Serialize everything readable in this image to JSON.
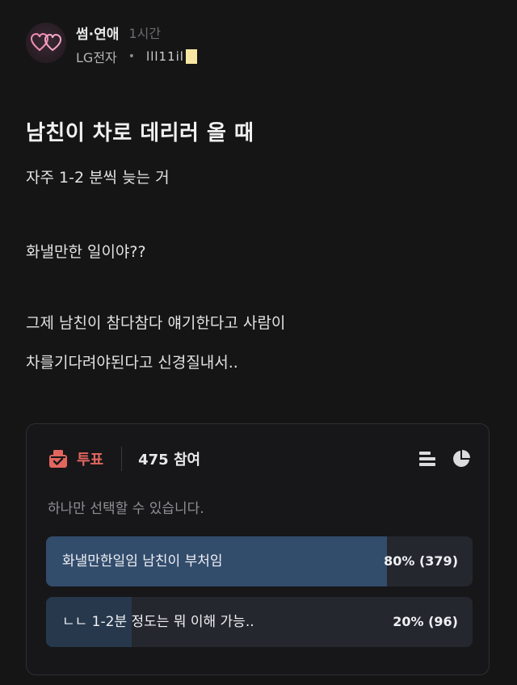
{
  "post": {
    "channel": "썸·연애",
    "time": "1시간",
    "company": "LG전자",
    "separator": "•",
    "nickname": "lll11il",
    "title": "남친이 차로 데리러 올 때",
    "body": [
      "자주 1-2 분씩 늦는 거",
      "화낼만한 일이야??",
      "그제 남친이 참다참다 얘기한다고 사람이",
      "차를기다려야된다고 신경질내서.."
    ]
  },
  "poll": {
    "label": "투표",
    "participants": "475 참여",
    "hint": "하나만 선택할 수 있습니다.",
    "options": [
      {
        "label": "화낼만한일임 남친이 부처임",
        "result": "80% (379)",
        "percent": 80
      },
      {
        "label": "ㄴㄴ 1-2분 정도는 뭐 이해 가능..",
        "result": "20% (96)",
        "percent": 20
      }
    ]
  },
  "icons": {
    "vote": "ballot-box-icon",
    "bar_view": "bar-list-icon",
    "pie_view": "pie-chart-icon",
    "avatar": "hearts-avatar"
  },
  "colors": {
    "vote_accent": "#e2665e",
    "bar_fill_selected": "#324c6c",
    "bar_fill": "#27384c"
  }
}
